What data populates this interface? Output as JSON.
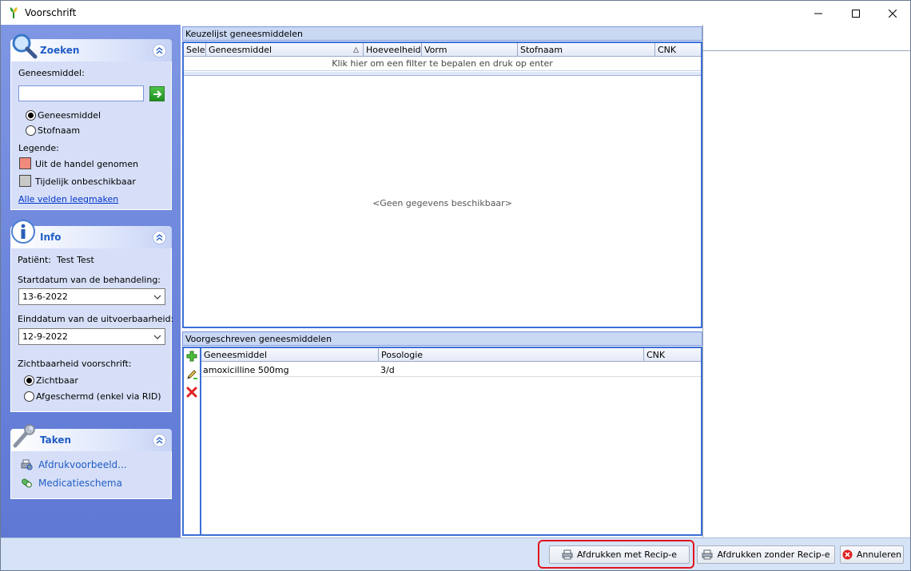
{
  "window": {
    "title": "Voorschrift",
    "controls": [
      "minimize-icon",
      "maximize-icon",
      "close-icon"
    ]
  },
  "search_group": {
    "title": "Zoeken",
    "field_label": "Geneesmiddel:",
    "field_value": "",
    "radio_options": [
      {
        "label": "Geneesmiddel",
        "selected": true
      },
      {
        "label": "Stofnaam",
        "selected": false
      }
    ],
    "legend_title": "Legende:",
    "legend": [
      {
        "label": "Uit de handel genomen",
        "color": "#f08a7c"
      },
      {
        "label": "Tijdelijk onbeschikbaar",
        "color": "#c8c8c8"
      }
    ],
    "clear_link": "Alle velden leegmaken"
  },
  "info_group": {
    "title": "Info",
    "patient_label": "Patiënt:",
    "patient_value": "Test Test",
    "start_label": "Startdatum van de behandeling:",
    "start_value": "13-6-2022",
    "end_label": "Einddatum van de uitvoerbaarheid:",
    "end_value": "12-9-2022",
    "visibility_label": "Zichtbaarheid voorschrift:",
    "visibility_options": [
      {
        "label": "Zichtbaar",
        "selected": true
      },
      {
        "label": "Afgeschermd (enkel via RID)",
        "selected": false
      }
    ]
  },
  "tasks_group": {
    "title": "Taken",
    "items": [
      {
        "label": "Afdrukvoorbeeld...",
        "icon": "print-preview-icon"
      },
      {
        "label": "Medicatieschema",
        "icon": "pill-icon"
      }
    ]
  },
  "selection_list": {
    "title": "Keuzelijst geneesmiddelen",
    "columns": [
      "Selec",
      "Geneesmiddel",
      "Hoeveelheid",
      "Vorm",
      "Stofnaam",
      "CNK"
    ],
    "filter_hint": "Klik hier om een filter te bepalen en druk op enter",
    "empty_text": "<Geen gegevens beschikbaar>"
  },
  "prescribed_list": {
    "title": "Voorgeschreven geneesmiddelen",
    "columns": [
      "Geneesmiddel",
      "Posologie",
      "CNK"
    ],
    "rows": [
      {
        "geneesmiddel": "amoxicilline 500mg",
        "posologie": "3/d",
        "cnk": ""
      }
    ],
    "tools": [
      "add-icon",
      "edit-icon",
      "delete-icon"
    ]
  },
  "footer": {
    "print_recipe": "Afdrukken met Recip-e",
    "print_no_recipe": "Afdrukken zonder Recip-e",
    "cancel": "Annuleren",
    "highlight_color": "#e0141c"
  }
}
